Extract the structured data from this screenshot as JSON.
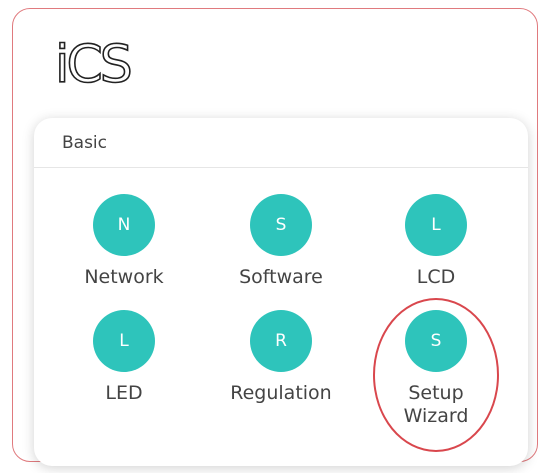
{
  "app": {
    "logo_text": "iCS"
  },
  "card": {
    "title": "Basic",
    "tiles": [
      {
        "letter": "N",
        "label": "Network"
      },
      {
        "letter": "S",
        "label": "Software"
      },
      {
        "letter": "L",
        "label": "LCD"
      },
      {
        "letter": "L",
        "label": "LED"
      },
      {
        "letter": "R",
        "label": "Regulation"
      },
      {
        "letter": "S",
        "label": "Setup Wizard"
      }
    ]
  },
  "colors": {
    "accent": "#2ec4bb",
    "frame_border": "#e07a7e",
    "highlight": "#d9474d"
  }
}
